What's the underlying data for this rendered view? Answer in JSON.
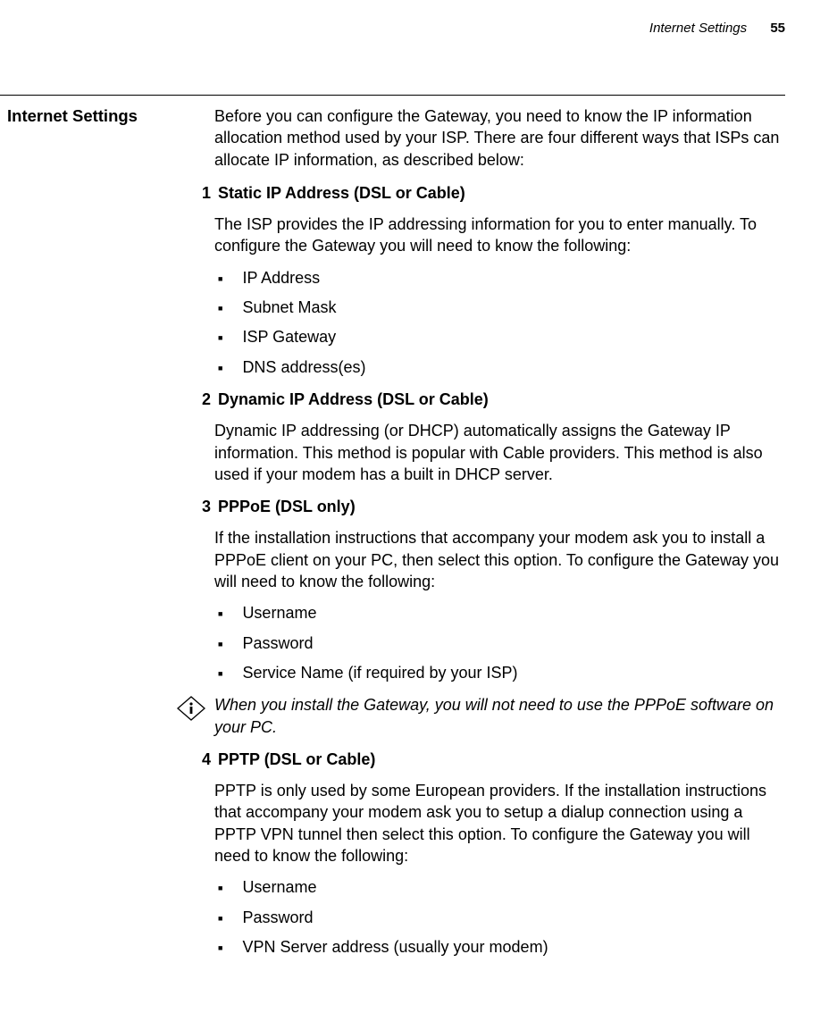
{
  "header": {
    "title": "Internet Settings",
    "page": "55"
  },
  "section_title": "Internet Settings",
  "intro": "Before you can configure the Gateway, you need to know the IP information allocation method used by your ISP. There are four different ways that ISPs can allocate IP information, as described below:",
  "items": [
    {
      "num": "1",
      "heading": "Static IP Address (DSL or Cable)",
      "para": "The ISP provides the IP addressing information for you to enter manually. To configure the Gateway you will need to know the following:",
      "bullets": [
        "IP Address",
        "Subnet Mask",
        "ISP Gateway",
        "DNS address(es)"
      ]
    },
    {
      "num": "2",
      "heading": "Dynamic IP Address (DSL or Cable)",
      "para": "Dynamic IP addressing (or DHCP) automatically assigns the Gateway IP information. This method is popular with Cable providers. This method is also used if your modem has a built in DHCP server."
    },
    {
      "num": "3",
      "heading": "PPPoE (DSL only)",
      "para": "If the installation instructions that accompany your modem ask you to install a PPPoE client on your PC, then select this option. To configure the Gateway you will need to know the following:",
      "bullets": [
        "Username",
        "Password",
        "Service Name (if required by your ISP)"
      ]
    }
  ],
  "note": "When you install the Gateway, you will not need to use the PPPoE software on your PC.",
  "items2": [
    {
      "num": "4",
      "heading": "PPTP (DSL or Cable)",
      "para": "PPTP is only used by some European providers. If the installation instructions that accompany your modem ask you to setup a dialup connection using a PPTP VPN tunnel then select this option. To configure the Gateway you will need to know the following:",
      "bullets": [
        "Username",
        "Password",
        "VPN Server address (usually your modem)"
      ]
    }
  ]
}
